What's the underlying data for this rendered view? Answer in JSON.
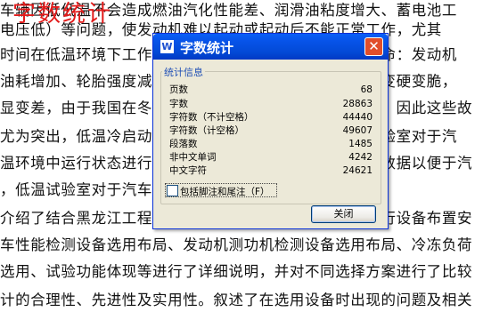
{
  "document": {
    "heading": "字数统计",
    "lines": [
      "车辆因低低温不会造成燃油汽化性能差、润滑油粘度增大、蓄电池工",
      "电压低）等问题，使发动机难以起动或起动后不能正常工作，尤其",
      "时间在低温环境下工作，这增加了发动机的磨损，缩短寿命：发动机",
      "油耗增加、轮胎强度减小，车辆的操纵稳定性因部件条件变硬变脆，",
      "显变差，由于我国在冬季北方地区气候寒冷，低温环境下，因此这些故",
      "尤为突出，低温冷启动试验是重要研究内容，需要低温试验室对于汽",
      "温环境中运行状态进行模拟，同时获得车辆各项性能试验数据以便于汽",
      "，低温试验室对于汽车设计的重要性是不言而喻的。",
      "介绍了结合黑龙江工程学院汽车工程中心现有场地条件进行设备布置安",
      "车性能检测设备选用布局、发动机测功机检测设备选用布局、冷冻负荷",
      "选用、试验功能体现等进行了详细说明，并对不同选择方案进行了比较",
      "计的合理性、先进性及实用性。叙述了在选用设备时出现的问题及相关"
    ]
  },
  "dialog": {
    "title": "字数统计",
    "app_icon_glyph": "W",
    "close_glyph": "✕",
    "group_title": "统计信息",
    "stats": [
      {
        "label": "页数",
        "value": "68"
      },
      {
        "label": "字数",
        "value": "28863"
      },
      {
        "label": "字符数（不计空格）",
        "value": "44440"
      },
      {
        "label": "字符数（计空格）",
        "value": "49607"
      },
      {
        "label": "段落数",
        "value": "1485"
      },
      {
        "label": "非中文单词",
        "value": "4242"
      },
      {
        "label": "中文字符",
        "value": "24621"
      }
    ],
    "checkbox_label": "包括脚注和尾注（F）",
    "checkbox_checked": false,
    "close_button_label": "关闭"
  },
  "colors": {
    "titlebar": "#0753e8",
    "dialog_bg": "#ece9d8",
    "heading_red": "#e21a1a",
    "group_title_blue": "#1f4fb5",
    "close_red": "#e14e2a"
  }
}
